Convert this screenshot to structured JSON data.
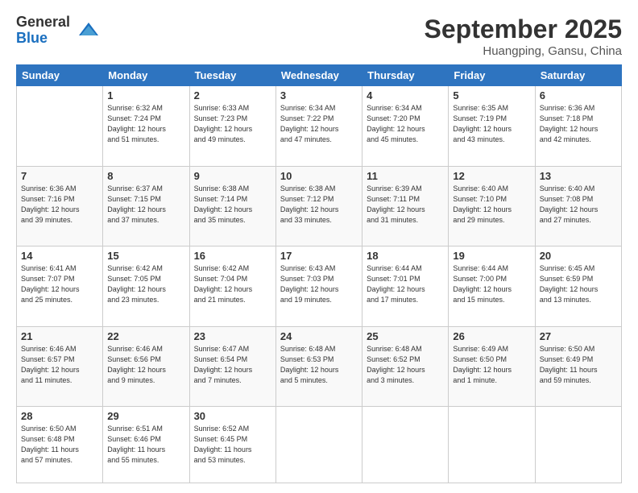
{
  "logo": {
    "general": "General",
    "blue": "Blue"
  },
  "title": "September 2025",
  "location": "Huangping, Gansu, China",
  "days_of_week": [
    "Sunday",
    "Monday",
    "Tuesday",
    "Wednesday",
    "Thursday",
    "Friday",
    "Saturday"
  ],
  "weeks": [
    [
      {
        "day": "",
        "info": ""
      },
      {
        "day": "1",
        "info": "Sunrise: 6:32 AM\nSunset: 7:24 PM\nDaylight: 12 hours\nand 51 minutes."
      },
      {
        "day": "2",
        "info": "Sunrise: 6:33 AM\nSunset: 7:23 PM\nDaylight: 12 hours\nand 49 minutes."
      },
      {
        "day": "3",
        "info": "Sunrise: 6:34 AM\nSunset: 7:22 PM\nDaylight: 12 hours\nand 47 minutes."
      },
      {
        "day": "4",
        "info": "Sunrise: 6:34 AM\nSunset: 7:20 PM\nDaylight: 12 hours\nand 45 minutes."
      },
      {
        "day": "5",
        "info": "Sunrise: 6:35 AM\nSunset: 7:19 PM\nDaylight: 12 hours\nand 43 minutes."
      },
      {
        "day": "6",
        "info": "Sunrise: 6:36 AM\nSunset: 7:18 PM\nDaylight: 12 hours\nand 42 minutes."
      }
    ],
    [
      {
        "day": "7",
        "info": "Sunrise: 6:36 AM\nSunset: 7:16 PM\nDaylight: 12 hours\nand 39 minutes."
      },
      {
        "day": "8",
        "info": "Sunrise: 6:37 AM\nSunset: 7:15 PM\nDaylight: 12 hours\nand 37 minutes."
      },
      {
        "day": "9",
        "info": "Sunrise: 6:38 AM\nSunset: 7:14 PM\nDaylight: 12 hours\nand 35 minutes."
      },
      {
        "day": "10",
        "info": "Sunrise: 6:38 AM\nSunset: 7:12 PM\nDaylight: 12 hours\nand 33 minutes."
      },
      {
        "day": "11",
        "info": "Sunrise: 6:39 AM\nSunset: 7:11 PM\nDaylight: 12 hours\nand 31 minutes."
      },
      {
        "day": "12",
        "info": "Sunrise: 6:40 AM\nSunset: 7:10 PM\nDaylight: 12 hours\nand 29 minutes."
      },
      {
        "day": "13",
        "info": "Sunrise: 6:40 AM\nSunset: 7:08 PM\nDaylight: 12 hours\nand 27 minutes."
      }
    ],
    [
      {
        "day": "14",
        "info": "Sunrise: 6:41 AM\nSunset: 7:07 PM\nDaylight: 12 hours\nand 25 minutes."
      },
      {
        "day": "15",
        "info": "Sunrise: 6:42 AM\nSunset: 7:05 PM\nDaylight: 12 hours\nand 23 minutes."
      },
      {
        "day": "16",
        "info": "Sunrise: 6:42 AM\nSunset: 7:04 PM\nDaylight: 12 hours\nand 21 minutes."
      },
      {
        "day": "17",
        "info": "Sunrise: 6:43 AM\nSunset: 7:03 PM\nDaylight: 12 hours\nand 19 minutes."
      },
      {
        "day": "18",
        "info": "Sunrise: 6:44 AM\nSunset: 7:01 PM\nDaylight: 12 hours\nand 17 minutes."
      },
      {
        "day": "19",
        "info": "Sunrise: 6:44 AM\nSunset: 7:00 PM\nDaylight: 12 hours\nand 15 minutes."
      },
      {
        "day": "20",
        "info": "Sunrise: 6:45 AM\nSunset: 6:59 PM\nDaylight: 12 hours\nand 13 minutes."
      }
    ],
    [
      {
        "day": "21",
        "info": "Sunrise: 6:46 AM\nSunset: 6:57 PM\nDaylight: 12 hours\nand 11 minutes."
      },
      {
        "day": "22",
        "info": "Sunrise: 6:46 AM\nSunset: 6:56 PM\nDaylight: 12 hours\nand 9 minutes."
      },
      {
        "day": "23",
        "info": "Sunrise: 6:47 AM\nSunset: 6:54 PM\nDaylight: 12 hours\nand 7 minutes."
      },
      {
        "day": "24",
        "info": "Sunrise: 6:48 AM\nSunset: 6:53 PM\nDaylight: 12 hours\nand 5 minutes."
      },
      {
        "day": "25",
        "info": "Sunrise: 6:48 AM\nSunset: 6:52 PM\nDaylight: 12 hours\nand 3 minutes."
      },
      {
        "day": "26",
        "info": "Sunrise: 6:49 AM\nSunset: 6:50 PM\nDaylight: 12 hours\nand 1 minute."
      },
      {
        "day": "27",
        "info": "Sunrise: 6:50 AM\nSunset: 6:49 PM\nDaylight: 11 hours\nand 59 minutes."
      }
    ],
    [
      {
        "day": "28",
        "info": "Sunrise: 6:50 AM\nSunset: 6:48 PM\nDaylight: 11 hours\nand 57 minutes."
      },
      {
        "day": "29",
        "info": "Sunrise: 6:51 AM\nSunset: 6:46 PM\nDaylight: 11 hours\nand 55 minutes."
      },
      {
        "day": "30",
        "info": "Sunrise: 6:52 AM\nSunset: 6:45 PM\nDaylight: 11 hours\nand 53 minutes."
      },
      {
        "day": "",
        "info": ""
      },
      {
        "day": "",
        "info": ""
      },
      {
        "day": "",
        "info": ""
      },
      {
        "day": "",
        "info": ""
      }
    ]
  ]
}
